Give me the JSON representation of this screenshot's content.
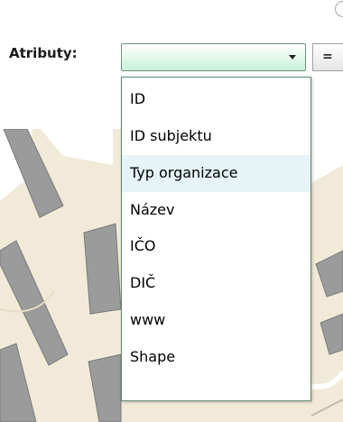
{
  "filter": {
    "label": "Atributy:",
    "select_value": "",
    "operator": "="
  },
  "dropdown": {
    "options": [
      "ID",
      "ID subjektu",
      "Typ organizace",
      "Název",
      "IČO",
      "DIČ",
      "www",
      "Shape"
    ],
    "highlighted": "Typ organizace"
  },
  "colors": {
    "select_gradient_bottom": "#c8f2d8",
    "dropdown_border": "#5e8a6f",
    "highlight": "#e6f3f7",
    "map_background": "#f1ead9",
    "building": "#9b9b9b"
  }
}
